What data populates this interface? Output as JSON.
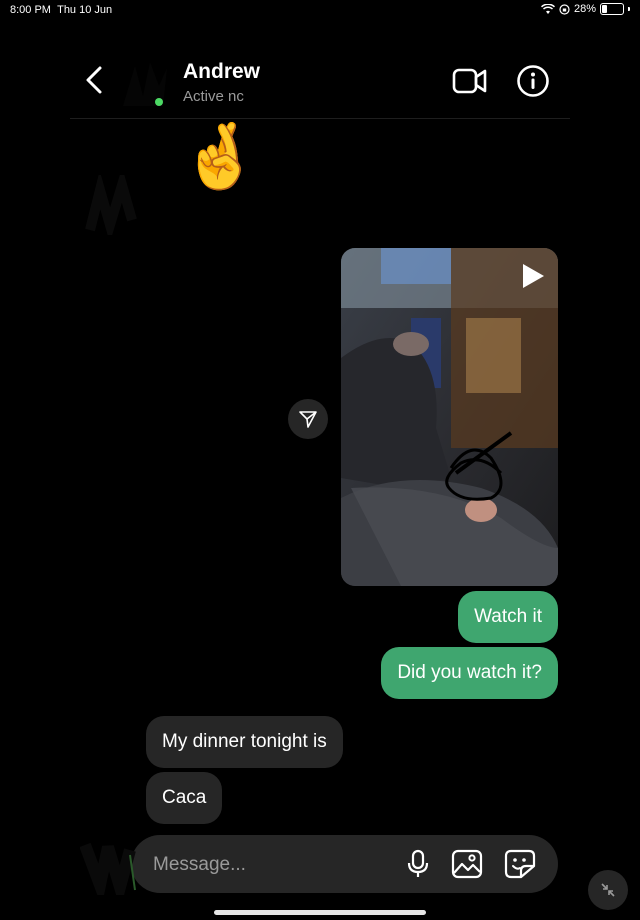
{
  "status_bar": {
    "time": "8:00 PM",
    "date": "Thu 10 Jun",
    "battery_percent": "28%",
    "battery_level": 0.28,
    "icons": [
      "wifi-icon",
      "lock-rotation-icon",
      "battery-icon"
    ]
  },
  "header": {
    "contact_name": "Andrew",
    "status_text": "Active nc",
    "icons": [
      "back-chevron-icon",
      "video-call-icon",
      "info-icon"
    ]
  },
  "messages": {
    "emoji": "🤞",
    "video_icon": "play-icon",
    "share_icon": "send-icon",
    "sent": [
      "Watch it",
      "Did you watch it?"
    ],
    "received": [
      "My dinner tonight is",
      "Caca"
    ]
  },
  "composer": {
    "placeholder": "Message...",
    "icons": [
      "microphone-icon",
      "gallery-icon",
      "sticker-icon"
    ]
  },
  "colors": {
    "sent_bubble": "#3fa66f",
    "received_bubble": "#262626",
    "background": "#000000",
    "active_dot": "#4cd964"
  }
}
